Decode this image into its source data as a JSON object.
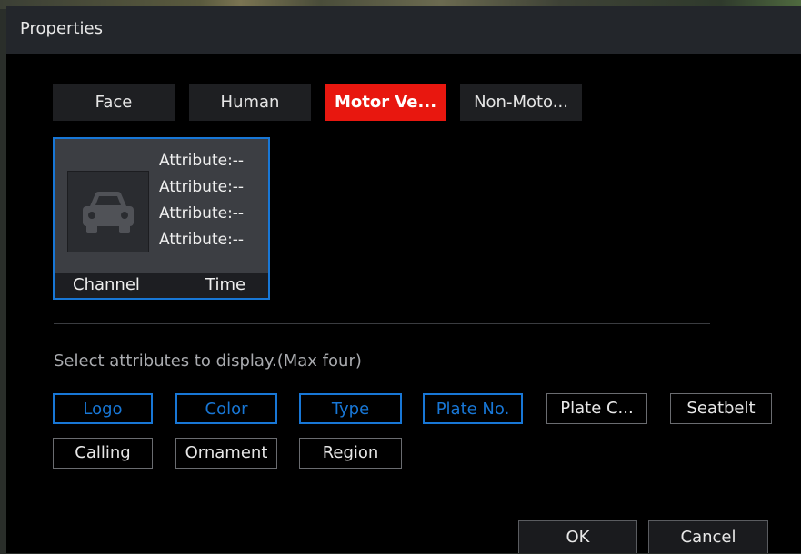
{
  "dialog": {
    "title": "Properties"
  },
  "tabs": [
    {
      "label": "Face"
    },
    {
      "label": "Human"
    },
    {
      "label": "Motor Ve...",
      "active": true
    },
    {
      "label": "Non-Moto..."
    }
  ],
  "preview": {
    "icon": "car-icon",
    "attributes": [
      "Attribute:--",
      "Attribute:--",
      "Attribute:--",
      "Attribute:--"
    ],
    "channel_label": "Channel",
    "time_label": "Time"
  },
  "select_hint": "Select attributes to display.(Max four)",
  "options": [
    {
      "label": "Logo",
      "checked": true
    },
    {
      "label": "Color",
      "checked": true
    },
    {
      "label": "Type",
      "checked": true
    },
    {
      "label": "Plate No.",
      "checked": true
    },
    {
      "label": "Plate C...",
      "checked": false
    },
    {
      "label": "Seatbelt",
      "checked": false
    },
    {
      "label": "Calling",
      "checked": false
    },
    {
      "label": "Ornament",
      "checked": false
    },
    {
      "label": "Region",
      "checked": false
    }
  ],
  "buttons": {
    "ok": "OK",
    "cancel": "Cancel"
  },
  "colors": {
    "accent_red": "#e8170f",
    "selected_blue": "#1877d6"
  }
}
